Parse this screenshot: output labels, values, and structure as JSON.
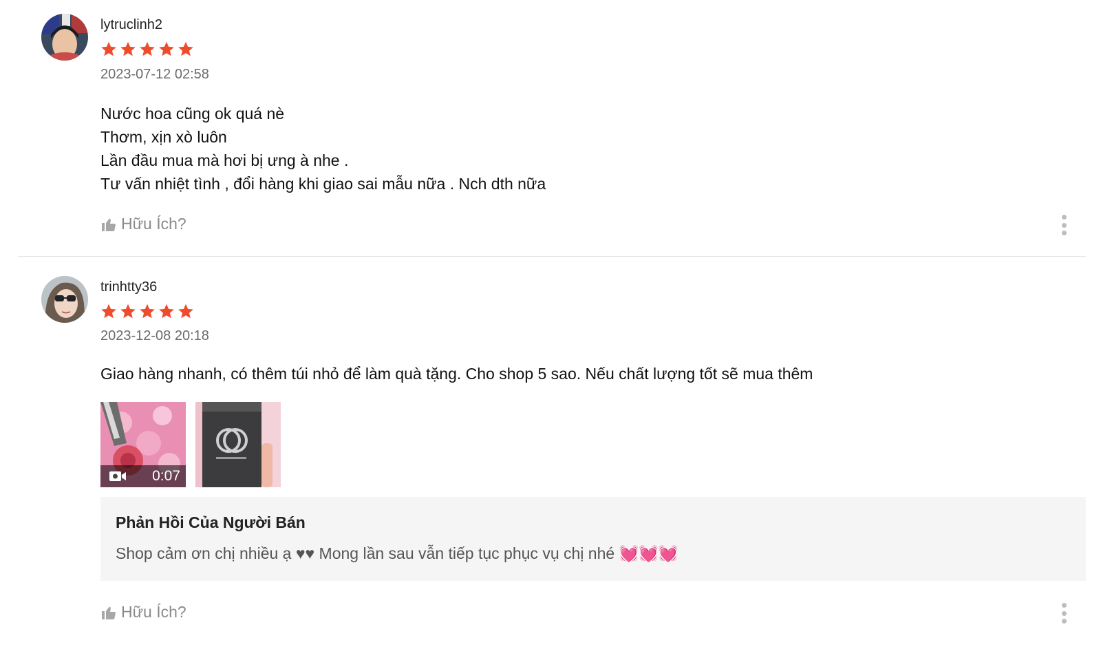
{
  "reviews": [
    {
      "username": "lytruclinh2",
      "rating": 5,
      "date": "2023-07-12 02:58",
      "lines": [
        "Nước hoa cũng ok quá nè",
        "Thơm, xịn xò luôn",
        "Lần đầu mua mà hơi bị ưng à nhe .",
        "Tư vấn nhiệt tình , đổi hàng khi giao sai mẫu nữa . Nch dth nữa"
      ],
      "helpful_label": "Hữu Ích?"
    },
    {
      "username": "trinhtty36",
      "rating": 5,
      "date": "2023-12-08 20:18",
      "lines": [
        "Giao hàng nhanh, có thêm túi nhỏ để làm quà tặng. Cho shop 5 sao. Nếu chất lượng tốt sẽ mua thêm"
      ],
      "media": {
        "video_duration": "0:07"
      },
      "seller_reply": {
        "title": "Phản Hồi Của Người Bán",
        "text": "Shop cảm ơn chị nhiều ạ ♥♥ Mong lần sau vẫn tiếp tục phục vụ chị nhé 💓💓💓"
      },
      "helpful_label": "Hữu Ích?"
    }
  ],
  "colors": {
    "star": "#ee4d2d",
    "muted_text": "#8a8a8a",
    "reply_bg": "#f5f5f5",
    "divider": "#e3e3e3"
  }
}
